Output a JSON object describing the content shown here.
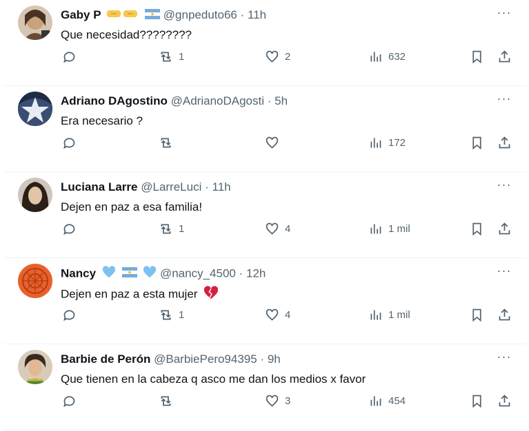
{
  "tweets": [
    {
      "name": "Gaby P",
      "handle": "@gnpeduto66",
      "time": "11h",
      "text": "Que necesidad????????",
      "replies": "",
      "retweets": "1",
      "likes": "2",
      "views": "632",
      "avatar_color": "#c8a27c"
    },
    {
      "name": "Adriano DAgostino",
      "handle": "@AdrianoDAgosti",
      "time": "5h",
      "text": "Era necesario ?",
      "replies": "",
      "retweets": "",
      "likes": "",
      "views": "172",
      "avatar_color": "#2a3a5c"
    },
    {
      "name": "Luciana Larre",
      "handle": "@LarreLuci",
      "time": "11h",
      "text": "Dejen en paz a esa familia!",
      "replies": "",
      "retweets": "1",
      "likes": "4",
      "views": "1 mil",
      "avatar_color": "#5b4636"
    },
    {
      "name": "Nancy",
      "handle": "@nancy_4500",
      "time": "12h",
      "text": "Dejen en paz a esta mujer",
      "replies": "",
      "retweets": "1",
      "likes": "4",
      "views": "1 mil",
      "avatar_color": "#d9541e"
    },
    {
      "name": "Barbie de Perón",
      "handle": "@BarbiePero94395",
      "time": "9h",
      "text": "Que tienen en la cabeza q asco me dan los medios x favor",
      "replies": "",
      "retweets": "",
      "likes": "3",
      "views": "454",
      "avatar_color": "#a07a60"
    }
  ],
  "ui": {
    "dot": "·",
    "more": "···"
  },
  "colors": {
    "accent": "#536471",
    "text": "#0f1419",
    "divider": "#eff3f4",
    "heart_blue": "#7cc1f2",
    "broken_heart": "#d6203f"
  }
}
